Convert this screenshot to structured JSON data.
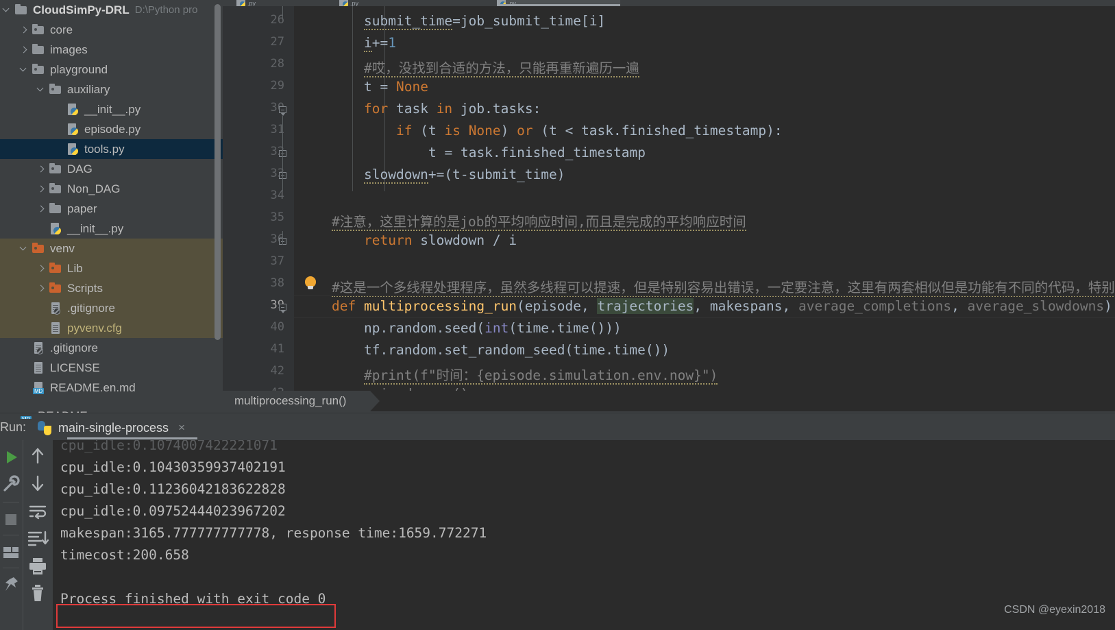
{
  "sidebar": {
    "scrollbar": true,
    "items": [
      {
        "label": "CloudSimPy-DRL",
        "suffix": "D:\\Python pro",
        "type": "folder",
        "arrow": "down",
        "indent": 0,
        "bold": true
      },
      {
        "label": "core",
        "type": "folder-dot",
        "arrow": "right",
        "indent": 1
      },
      {
        "label": "images",
        "type": "folder",
        "arrow": "right",
        "indent": 1
      },
      {
        "label": "playground",
        "type": "folder-dot",
        "arrow": "down",
        "indent": 1
      },
      {
        "label": "auxiliary",
        "type": "folder-dot",
        "arrow": "down",
        "indent": 2
      },
      {
        "label": "__init__.py",
        "type": "py",
        "arrow": "none",
        "indent": 3
      },
      {
        "label": "episode.py",
        "type": "py",
        "arrow": "none",
        "indent": 3
      },
      {
        "label": "tools.py",
        "type": "py",
        "arrow": "none",
        "indent": 3,
        "selected": true
      },
      {
        "label": "DAG",
        "type": "folder-dot",
        "arrow": "right",
        "indent": 2
      },
      {
        "label": "Non_DAG",
        "type": "folder-dot",
        "arrow": "right",
        "indent": 2
      },
      {
        "label": "paper",
        "type": "folder",
        "arrow": "right",
        "indent": 2
      },
      {
        "label": "__init__.py",
        "type": "py",
        "arrow": "none",
        "indent": 2
      },
      {
        "label": "venv",
        "type": "folder-orange",
        "arrow": "down",
        "indent": 1,
        "venvhl": true
      },
      {
        "label": "Lib",
        "type": "folder-orange",
        "arrow": "right",
        "indent": 2,
        "venvhl": true
      },
      {
        "label": "Scripts",
        "type": "folder-orange",
        "arrow": "right",
        "indent": 2,
        "venvhl": true
      },
      {
        "label": ".gitignore",
        "type": "git",
        "arrow": "none",
        "indent": 2,
        "venvhl": true
      },
      {
        "label": "pyvenv.cfg",
        "type": "doc",
        "arrow": "none",
        "indent": 2,
        "venvhl": true,
        "tan": true
      },
      {
        "label": ".gitignore",
        "type": "git",
        "arrow": "none",
        "indent": 1
      },
      {
        "label": "LICENSE",
        "type": "doc",
        "arrow": "none",
        "indent": 1
      },
      {
        "label": "README.en.md",
        "type": "md",
        "arrow": "none",
        "indent": 1
      },
      {
        "label": "README",
        "type": "md",
        "arrow": "none",
        "indent": 1,
        "clipped": true
      }
    ]
  },
  "editor": {
    "tabs": [
      {
        "label": ".py",
        "active": false
      },
      {
        "label": ".py",
        "active": false
      },
      {
        "label": ".py",
        "active": true
      }
    ],
    "breadcrumb": "multiprocessing_run()",
    "first_line_number": 26,
    "current_line": 39,
    "lines": [
      {
        "n": 26,
        "indent": 2,
        "segments": [
          {
            "t": "submit_time",
            "c": "param",
            "squig": true
          },
          {
            "t": "=",
            "c": ""
          },
          {
            "t": "job_submit_time[i]",
            "c": ""
          }
        ]
      },
      {
        "n": 27,
        "indent": 2,
        "segments": [
          {
            "t": "i",
            "c": "param",
            "squig": true
          },
          {
            "t": "+=",
            "c": ""
          },
          {
            "t": "1",
            "c": "num"
          }
        ]
      },
      {
        "n": 28,
        "indent": 2,
        "segments": [
          {
            "t": "#哎，没找到合适的方法，只能再重新遍历一遍",
            "c": "cmt",
            "squig": true
          }
        ]
      },
      {
        "n": 29,
        "indent": 2,
        "segments": [
          {
            "t": "t = ",
            "c": ""
          },
          {
            "t": "None",
            "c": "kw"
          }
        ]
      },
      {
        "n": 30,
        "indent": 2,
        "fold": "tri",
        "segments": [
          {
            "t": "for",
            "c": "kw"
          },
          {
            "t": " task ",
            "c": ""
          },
          {
            "t": "in",
            "c": "kw"
          },
          {
            "t": " job.tasks:",
            "c": ""
          }
        ]
      },
      {
        "n": 31,
        "indent": 3,
        "segments": [
          {
            "t": "if",
            "c": "kw"
          },
          {
            "t": " (t ",
            "c": ""
          },
          {
            "t": "is",
            "c": "kw"
          },
          {
            "t": " ",
            "c": ""
          },
          {
            "t": "None",
            "c": "kw"
          },
          {
            "t": ") ",
            "c": ""
          },
          {
            "t": "or",
            "c": "kw"
          },
          {
            "t": " (t < task.finished_timestamp):",
            "c": ""
          }
        ]
      },
      {
        "n": 32,
        "indent": 4,
        "fold": "sq",
        "segments": [
          {
            "t": "t = task.finished_timestamp",
            "c": ""
          }
        ]
      },
      {
        "n": 33,
        "indent": 2,
        "fold": "sq",
        "segments": [
          {
            "t": "slowdown",
            "c": "param",
            "squig": true
          },
          {
            "t": "+=(t-submit_time)",
            "c": ""
          }
        ]
      },
      {
        "n": 34,
        "indent": 0,
        "segments": []
      },
      {
        "n": 35,
        "indent": 1,
        "segments": [
          {
            "t": "#注意，这里计算的是job的平均响应时间,而且是完成的平均响应时间",
            "c": "cmt",
            "squig": true
          }
        ]
      },
      {
        "n": 36,
        "indent": 2,
        "fold": "sq",
        "segments": [
          {
            "t": "return",
            "c": "kw"
          },
          {
            "t": " slowdown / i",
            "c": ""
          }
        ]
      },
      {
        "n": 37,
        "indent": 0,
        "segments": []
      },
      {
        "n": 38,
        "indent": 1,
        "segments": [
          {
            "t": "#这是一个多线程处理程序，虽然多线程可以提速，但是特别容易出错误，一定要注意，这里有两套相似但是功能有不同的代码，特别容易混",
            "c": "cmt",
            "squig": true
          }
        ]
      },
      {
        "n": 39,
        "indent": 1,
        "fold": "tri",
        "current": true,
        "segments": [
          {
            "t": "def",
            "c": "kw"
          },
          {
            "t": " ",
            "c": ""
          },
          {
            "t": "multiprocessing_run",
            "c": "fn"
          },
          {
            "t": "(",
            "c": ""
          },
          {
            "t": "episode",
            "c": "param"
          },
          {
            "t": ", ",
            "c": ""
          },
          {
            "t": "trajectories",
            "c": "param-hl"
          },
          {
            "t": ", ",
            "c": ""
          },
          {
            "t": "makespans",
            "c": "param"
          },
          {
            "t": ", ",
            "c": ""
          },
          {
            "t": "average_completions",
            "c": "dim"
          },
          {
            "t": ", ",
            "c": ""
          },
          {
            "t": "average_slowdowns",
            "c": "dim"
          },
          {
            "t": "):",
            "c": ""
          }
        ]
      },
      {
        "n": 40,
        "indent": 2,
        "segments": [
          {
            "t": "np.random.seed(",
            "c": ""
          },
          {
            "t": "int",
            "c": "bi"
          },
          {
            "t": "(time.time()))",
            "c": ""
          }
        ]
      },
      {
        "n": 41,
        "indent": 2,
        "segments": [
          {
            "t": "tf.random.set_random_seed(time.time())",
            "c": ""
          }
        ]
      },
      {
        "n": 42,
        "indent": 2,
        "segments": [
          {
            "t": "#print(f\"时间：{episode.simulation.env.now}\")",
            "c": "cmt",
            "squig": true
          }
        ]
      },
      {
        "n": 43,
        "indent": 2,
        "clipped": true,
        "segments": [
          {
            "t": "episode_run()",
            "c": "cmt"
          }
        ]
      }
    ]
  },
  "run_panel": {
    "run_label": "Run:",
    "tab_name": "main-single-process",
    "close_label": "×",
    "toolbar_left": [
      "run-icon",
      "settings-icon",
      "stop-icon",
      "layout-icon",
      "pin-icon"
    ],
    "toolbar_right": [
      "up-arrow-icon",
      "down-arrow-icon",
      "soft-wrap-icon",
      "scroll-to-end-icon",
      "print-icon",
      "trash-icon"
    ],
    "output_lines": [
      {
        "text": "cpu_idle:0.1074007422221071",
        "clipped": true
      },
      {
        "text": "cpu_idle:0.10430359937402191"
      },
      {
        "text": "cpu_idle:0.11236042183622828"
      },
      {
        "text": "cpu_idle:0.09752444023967202"
      },
      {
        "text": "makespan:3165.777777777778, response time:1659.772271"
      },
      {
        "text": "timecost:200.658"
      },
      {
        "text": ""
      },
      {
        "text": "Process finished with exit code 0",
        "boxed": true
      }
    ],
    "exit_box_color": "#e03a3a"
  },
  "watermark": "CSDN @eyexin2018",
  "colors": {
    "sidebar_bg": "#3c3f41",
    "editor_bg": "#2b2b2b",
    "selection_blue": "#0d293e",
    "venv_highlight": "#55503c",
    "keyword_orange": "#cc7832",
    "function_yellow": "#ffc66d",
    "number_blue": "#6897bb",
    "comment_gray": "#808080",
    "text_default": "#a9b7c6"
  }
}
